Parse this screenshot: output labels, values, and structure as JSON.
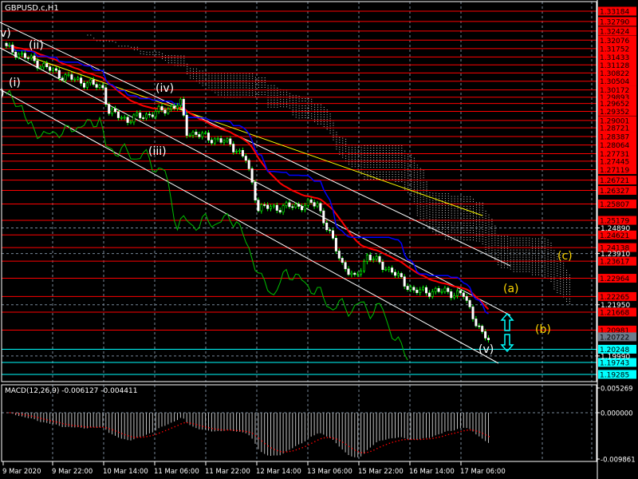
{
  "symbol_title": "GBPUSD.c,H1",
  "colors": {
    "background": "#000000",
    "level_line": "#ff0000",
    "support_line": "#00ffff",
    "bid_label": "#6e7b8b",
    "ma_red": "#ff0000",
    "ma_blue": "#0000ff",
    "lagging": "#00c000",
    "trend_yellow": "#ffff00",
    "wave_label_yellow": "#ffd700",
    "macd_signal": "#ff0000",
    "macd_hist": "#c0c0c0"
  },
  "chart_data": {
    "type": "candlestick",
    "title": "GBPUSD.c,H1",
    "timeframe": "H1",
    "ylim": [
      1.19009,
      1.33612
    ],
    "red_levels": [
      "1.33184",
      "1.32790",
      "1.32424",
      "1.32076",
      "1.31752",
      "1.31433",
      "1.31128",
      "1.30822",
      "1.30504",
      "1.30172",
      "1.29893",
      "1.29652",
      "1.29352",
      "1.29001",
      "1.28721",
      "1.28387",
      "1.28064",
      "1.27731",
      "1.27445",
      "1.27119",
      "1.26721",
      "1.26327",
      "1.25807",
      "1.25179",
      "1.24621",
      "1.24138",
      "1.23617",
      "1.22964",
      "1.22265",
      "1.21668",
      "1.20981"
    ],
    "cyan_levels": [
      "1.20248",
      "1.19743",
      "1.19285"
    ],
    "axis_ticks": [
      "1.24890",
      "1.23910",
      "1.21950",
      "1.19990"
    ],
    "current_price": "1.20722",
    "close_waypoints": [
      [
        0,
        1.31779
      ],
      [
        8,
        1.31321
      ],
      [
        18,
        1.3071
      ],
      [
        31,
        1.30251
      ],
      [
        33,
        1.29335
      ],
      [
        39,
        1.29029
      ],
      [
        49,
        1.29335
      ],
      [
        56,
        1.2964
      ],
      [
        58,
        1.28571
      ],
      [
        72,
        1.28113
      ],
      [
        77,
        1.27502
      ],
      [
        81,
        1.25669
      ],
      [
        88,
        1.25669
      ],
      [
        100,
        1.25822
      ],
      [
        103,
        1.24905
      ],
      [
        108,
        1.2353
      ],
      [
        112,
        1.22919
      ],
      [
        116,
        1.23836
      ],
      [
        124,
        1.23225
      ],
      [
        131,
        1.22462
      ],
      [
        141,
        1.22462
      ],
      [
        147,
        1.22309
      ],
      [
        150,
        1.21548
      ],
      [
        153,
        1.20781
      ],
      [
        155,
        1.20628
      ]
    ],
    "time_labels": [
      "9 Mar 2020",
      "9 Mar 22:00",
      "10 Mar 14:00",
      "11 Mar 06:00",
      "11 Mar 22:00",
      "12 Mar 14:00",
      "13 Mar 06:00",
      "15 Mar 22:00",
      "16 Mar 14:00",
      "17 Mar 06:00"
    ],
    "wave_labels": [
      {
        "text": "v)",
        "color": "white"
      },
      {
        "text": "(ii)",
        "color": "white"
      },
      {
        "text": "(i)",
        "color": "white"
      },
      {
        "text": ")",
        "color": "white"
      },
      {
        "text": "(iv)",
        "color": "white"
      },
      {
        "text": "(iii)",
        "color": "white"
      },
      {
        "text": "(v)",
        "color": "white"
      },
      {
        "text": "(a)",
        "color": "yellow"
      },
      {
        "text": "(b)",
        "color": "yellow"
      },
      {
        "text": "(c)",
        "color": "yellow"
      }
    ],
    "macd": {
      "label": "MACD(12,26,9) -0.006127 -0.004411",
      "params": "12,26,9",
      "main": -0.006127,
      "signal": -0.004411,
      "ylim": [
        -0.009861,
        0.005269
      ],
      "tick_labels": [
        "0.005269",
        "0.000000",
        "-0.009861"
      ]
    }
  }
}
